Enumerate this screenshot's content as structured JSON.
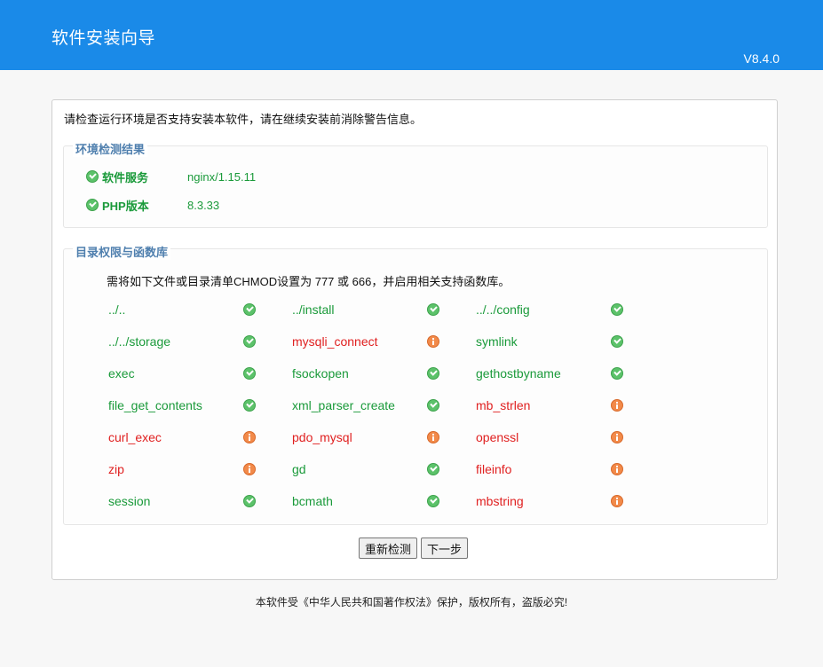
{
  "header": {
    "title": "软件安装向导",
    "version": "V8.4.0"
  },
  "intro": "请检查运行环境是否支持安装本软件，请在继续安装前消除警告信息。",
  "env": {
    "legend": "环境检测结果",
    "items": [
      {
        "label": "软件服务",
        "value": "nginx/1.15.11",
        "status": "ok"
      },
      {
        "label": "PHP版本",
        "value": "8.3.33",
        "status": "ok"
      }
    ]
  },
  "perms": {
    "legend": "目录权限与函数库",
    "note": "需将如下文件或目录清单CHMOD设置为 777 或 666，并启用相关支持函数库。",
    "items": [
      {
        "name": "../..",
        "status": "ok"
      },
      {
        "name": "../install",
        "status": "ok"
      },
      {
        "name": "../../config",
        "status": "ok"
      },
      {
        "name": "../../storage",
        "status": "ok"
      },
      {
        "name": "mysqli_connect",
        "status": "warn"
      },
      {
        "name": "symlink",
        "status": "ok"
      },
      {
        "name": "exec",
        "status": "ok"
      },
      {
        "name": "fsockopen",
        "status": "ok"
      },
      {
        "name": "gethostbyname",
        "status": "ok"
      },
      {
        "name": "file_get_contents",
        "status": "ok"
      },
      {
        "name": "xml_parser_create",
        "status": "ok"
      },
      {
        "name": "mb_strlen",
        "status": "warn"
      },
      {
        "name": "curl_exec",
        "status": "warn"
      },
      {
        "name": "pdo_mysql",
        "status": "warn"
      },
      {
        "name": "openssl",
        "status": "warn"
      },
      {
        "name": "zip",
        "status": "warn"
      },
      {
        "name": "gd",
        "status": "ok"
      },
      {
        "name": "fileinfo",
        "status": "warn"
      },
      {
        "name": "session",
        "status": "ok"
      },
      {
        "name": "bcmath",
        "status": "ok"
      },
      {
        "name": "mbstring",
        "status": "warn"
      }
    ]
  },
  "buttons": {
    "recheck": "重新检测",
    "next": "下一步"
  },
  "footer": "本软件受《中华人民共和国著作权法》保护，版权所有，盗版必究!"
}
